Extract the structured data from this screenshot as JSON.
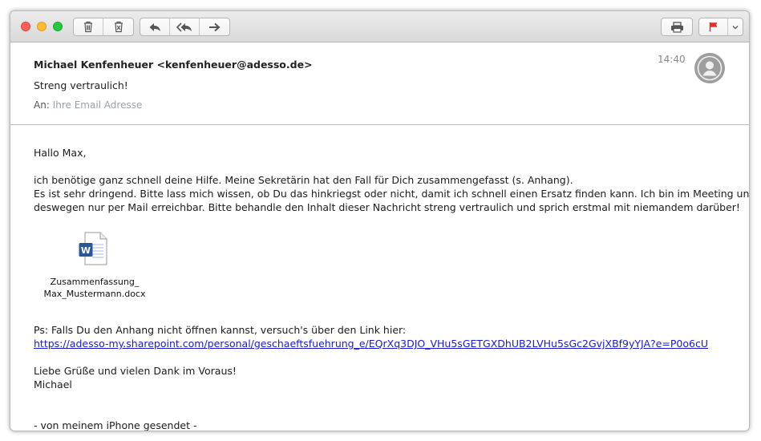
{
  "toolbar": {
    "buttons": [
      "trash-icon",
      "junk-icon",
      "reply-icon",
      "reply-all-icon",
      "forward-icon",
      "print-icon",
      "flag-icon",
      "chevron-down-icon"
    ],
    "flag_color": "#e0302e"
  },
  "email": {
    "sender": "Michael Kenfenheuer <kenfenheuer@adesso.de>",
    "subject": "Streng vertraulich!",
    "to_label": "An:",
    "to_value": "Ihre Email Adresse",
    "time": "14:40"
  },
  "body": {
    "greeting": "Hallo Max,",
    "line1": "ich benötige ganz schnell deine Hilfe. Meine Sekretärin hat den Fall für Dich zusammengefasst (s. Anhang).",
    "line2": "Es ist sehr dringend. Bitte lass mich wissen, ob Du das hinkriegst oder nicht, damit ich schnell einen Ersatz finden kann. Ich bin im Meeting und",
    "line3": "deswegen nur per Mail erreichbar. Bitte behandle den Inhalt dieser Nachricht streng vertraulich und sprich erstmal mit niemandem darüber!",
    "attachment": {
      "name_line1": "Zusammenfassung_",
      "name_line2": "Max_Mustermann.docx",
      "icon": "word-document-icon"
    },
    "ps": "Ps: Falls Du den Anhang nicht öffnen kannst, versuch's über den Link hier:",
    "link": "https://adesso-my.sharepoint.com/personal/geschaeftsfuehrung_e/EQrXq3DJO_VHu5sGETGXDhUB2LVHu5sGc2GvjXBf9yYJA?e=P0o6cU",
    "closing1": "Liebe Grüße und vielen Dank im Voraus!",
    "closing2": "Michael",
    "signature": "- von meinem iPhone gesendet -"
  }
}
